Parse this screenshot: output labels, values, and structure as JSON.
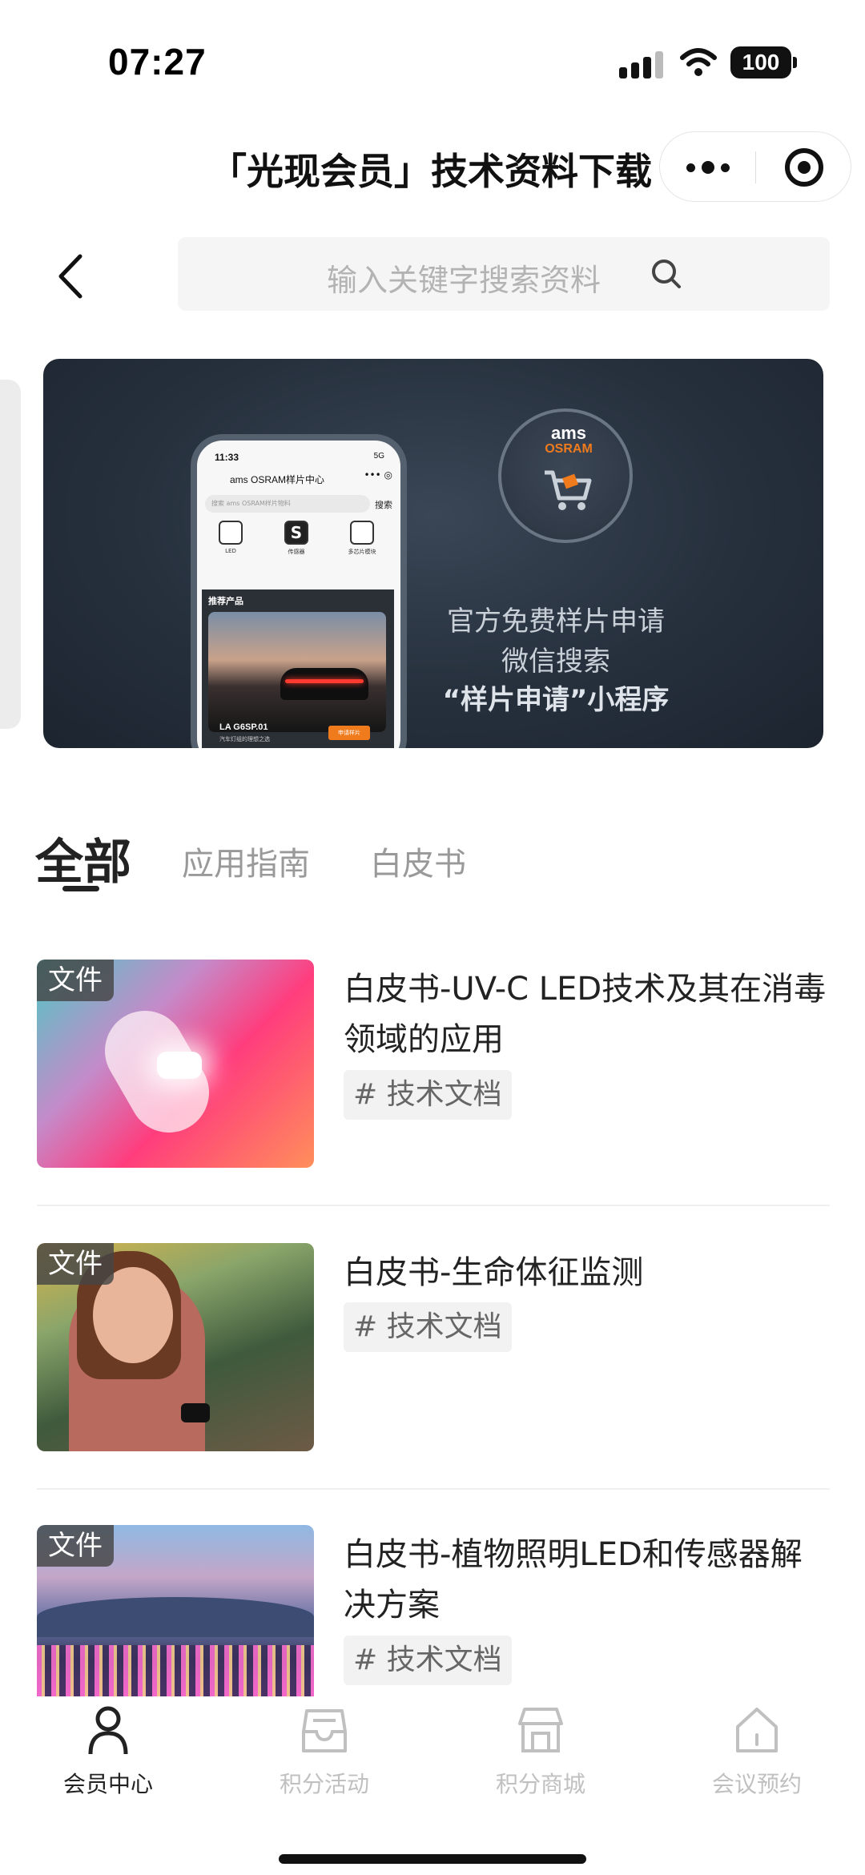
{
  "status_bar": {
    "time": "07:27",
    "battery": "100"
  },
  "header": {
    "title": "「光现会员」技术资料下载"
  },
  "search": {
    "placeholder": "输入关键字搜索资料"
  },
  "banner": {
    "line1": "官方免费样片申请",
    "line2": "微信搜索",
    "line3": "“样片申请”小程序",
    "logo_brand": "ams",
    "logo_brand2": "OSRAM",
    "phone": {
      "time": "11:33",
      "status": "5G",
      "title": "ams OSRAM样片中心",
      "search_placeholder": "搜索 ams OSRAM样片物料",
      "search_button": "搜索",
      "icons": [
        {
          "label": "LED"
        },
        {
          "label": "传感器",
          "glyph": "S"
        },
        {
          "label": "多芯片模块"
        }
      ],
      "card_title": "推荐产品",
      "product_name": "LA G6SP.01",
      "product_sub": "汽车灯组的理想之选",
      "apply_button": "申请样片"
    }
  },
  "tabs": [
    {
      "label": "全部",
      "active": true
    },
    {
      "label": "应用指南",
      "active": false
    },
    {
      "label": "白皮书",
      "active": false
    }
  ],
  "items": [
    {
      "badge": "文件",
      "title": "白皮书-UV-C LED技术及其在消毒领域的应用",
      "tag": "# 技术文档"
    },
    {
      "badge": "文件",
      "title": "白皮书-生命体征监测",
      "tag": "# 技术文档"
    },
    {
      "badge": "文件",
      "title": "白皮书-植物照明LED和传感器解决方案",
      "tag": "# 技术文档"
    }
  ],
  "bottom_nav": [
    {
      "label": "会员中心",
      "icon": "person-icon",
      "active": true
    },
    {
      "label": "积分活动",
      "icon": "inbox-icon",
      "active": false
    },
    {
      "label": "积分商城",
      "icon": "store-icon",
      "active": false
    },
    {
      "label": "会议预约",
      "icon": "home-icon",
      "active": false
    }
  ],
  "colors": {
    "accent_orange": "#f07b1d",
    "nav_active": "#222222",
    "nav_inactive": "#c0c0c0"
  }
}
